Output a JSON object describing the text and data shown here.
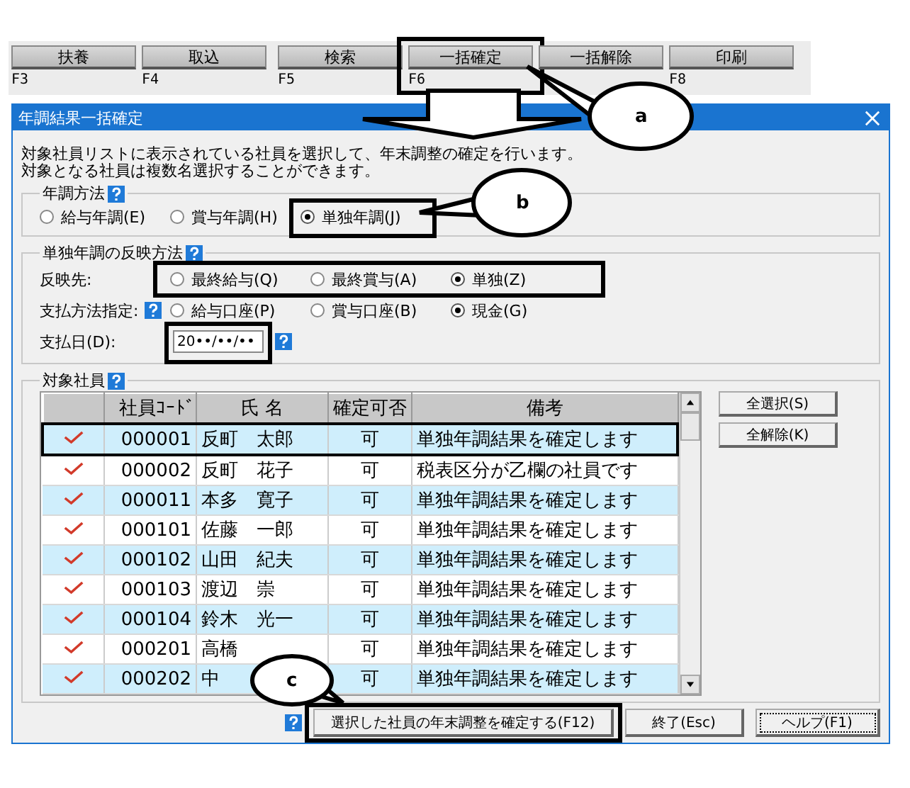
{
  "toolbar": {
    "buttons": [
      {
        "label": "扶養",
        "key": "F3",
        "highlighted": false
      },
      {
        "label": "取込",
        "key": "F4",
        "highlighted": false
      },
      {
        "label": "検索",
        "key": "F5",
        "highlighted": false
      },
      {
        "label": "一括確定",
        "key": "F6",
        "highlighted": true
      },
      {
        "label": "一括解除",
        "highlighted": false
      },
      {
        "label": "印刷",
        "key": "F8",
        "highlighted": false
      }
    ]
  },
  "dialog": {
    "title": "年調結果一括確定",
    "description": [
      "対象社員リストに表示されている社員を選択して、年末調整の確定を行います。",
      "対象となる社員は複数名選択することができます。"
    ],
    "method": {
      "legend": "年調方法",
      "options": [
        {
          "label": "給与年調(E)",
          "selected": false,
          "highlighted": false
        },
        {
          "label": "賞与年調(H)",
          "selected": false,
          "highlighted": false
        },
        {
          "label": "単独年調(J)",
          "selected": true,
          "highlighted": true
        }
      ]
    },
    "reflect": {
      "legend": "単独年調の反映方法",
      "rows": [
        {
          "label": "反映先:",
          "help": false,
          "highlighted": true,
          "options": [
            {
              "label": "最終給与(Q)",
              "selected": false
            },
            {
              "label": "最終賞与(A)",
              "selected": false
            },
            {
              "label": "単独(Z)",
              "selected": true
            }
          ]
        },
        {
          "label": "支払方法指定:",
          "help": true,
          "highlighted": false,
          "options": [
            {
              "label": "給与口座(P)",
              "selected": false
            },
            {
              "label": "賞与口座(B)",
              "selected": false
            },
            {
              "label": "現金(G)",
              "selected": true
            }
          ]
        }
      ],
      "date": {
        "label": "支払日(D):",
        "value": "20••/••/••",
        "highlighted": true
      }
    },
    "employees": {
      "legend": "対象社員",
      "columns": [
        "社員ｺｰﾄﾞ",
        "氏 名",
        "確定可否",
        "備考"
      ],
      "rows": [
        {
          "checked": true,
          "selected": true,
          "code": "000001",
          "name": "反町　太郎",
          "status": "可",
          "note": "単独年調結果を確定します"
        },
        {
          "checked": true,
          "selected": false,
          "code": "000002",
          "name": "反町　花子",
          "status": "可",
          "note": "税表区分が乙欄の社員です"
        },
        {
          "checked": true,
          "selected": false,
          "code": "000011",
          "name": "本多　寛子",
          "status": "可",
          "note": "単独年調結果を確定します"
        },
        {
          "checked": true,
          "selected": false,
          "code": "000101",
          "name": "佐藤　一郎",
          "status": "可",
          "note": "単独年調結果を確定します"
        },
        {
          "checked": true,
          "selected": false,
          "code": "000102",
          "name": "山田　紀夫",
          "status": "可",
          "note": "単独年調結果を確定します"
        },
        {
          "checked": true,
          "selected": false,
          "code": "000103",
          "name": "渡辺　崇",
          "status": "可",
          "note": "単独年調結果を確定します"
        },
        {
          "checked": true,
          "selected": false,
          "code": "000104",
          "name": "鈴木　光一",
          "status": "可",
          "note": "単独年調結果を確定します"
        },
        {
          "checked": true,
          "selected": false,
          "code": "000201",
          "name": "高橋",
          "status": "可",
          "note": "単独年調結果を確定します"
        },
        {
          "checked": true,
          "selected": false,
          "code": "000202",
          "name": "中",
          "status": "可",
          "note": "単独年調結果を確定します"
        }
      ],
      "side_buttons": [
        "全選択(S)",
        "全解除(K)"
      ]
    },
    "footer_buttons": [
      {
        "label": "選択した社員の年末調整を確定する(F12)",
        "highlighted": true
      },
      {
        "label": "終了(Esc)",
        "highlighted": false
      },
      {
        "label": "ヘルプ(F1)",
        "highlighted": false
      }
    ]
  },
  "callouts": [
    "a",
    "b",
    "c"
  ]
}
